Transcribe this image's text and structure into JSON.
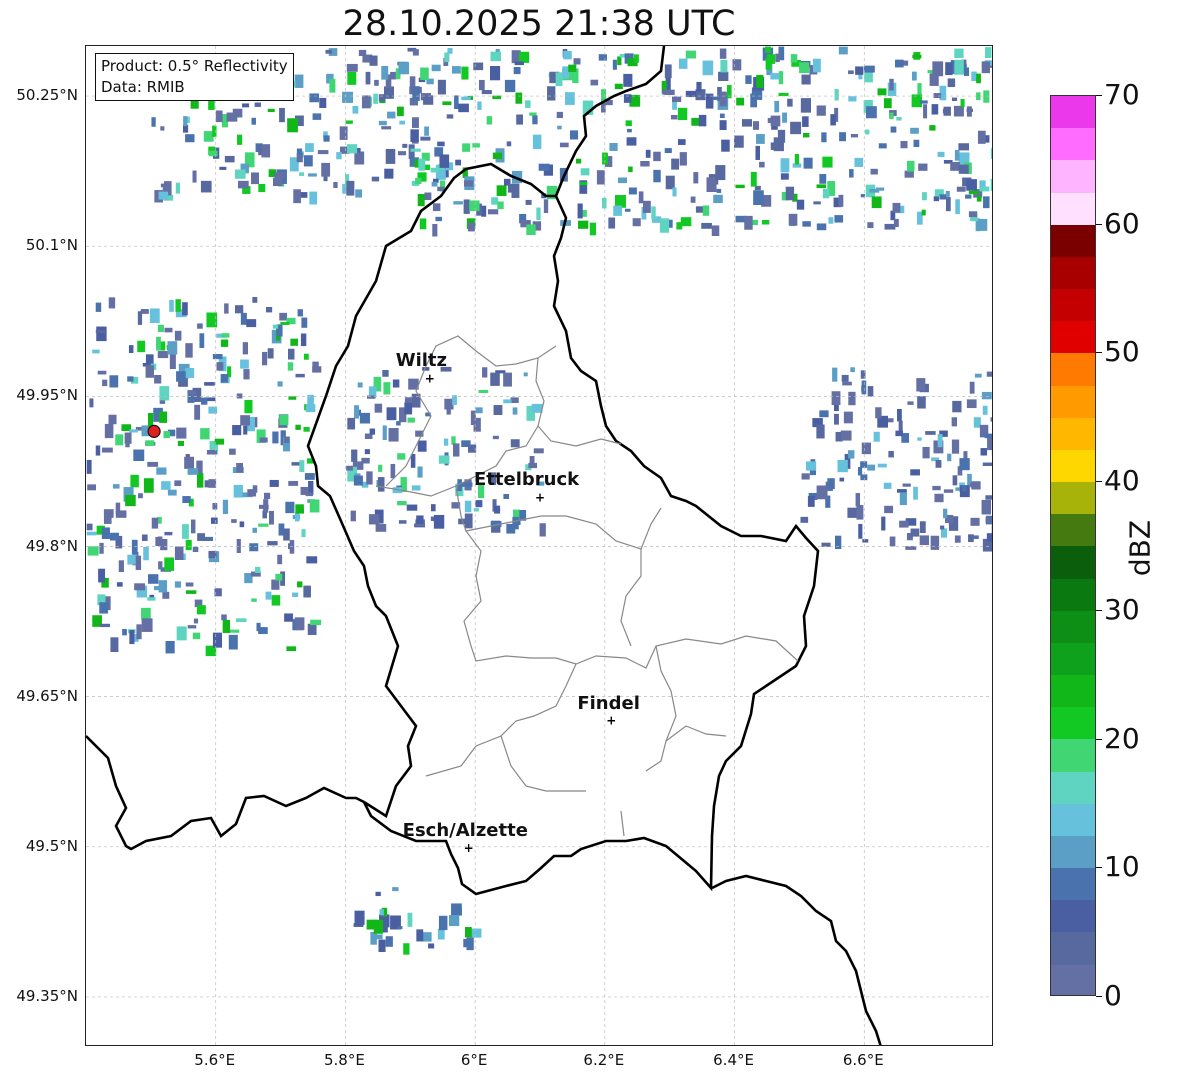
{
  "title": "28.10.2025 21:38 UTC",
  "info": {
    "product": "Product: 0.5° Reflectivity",
    "data_source": "Data: RMIB"
  },
  "axes": {
    "lat_labels": [
      "50.25°N",
      "50.1°N",
      "49.95°N",
      "49.8°N",
      "49.65°N",
      "49.5°N",
      "49.35°N"
    ],
    "lon_labels": [
      "5.6°E",
      "5.8°E",
      "6°E",
      "6.2°E",
      "6.4°E",
      "6.6°E"
    ],
    "lat_values": [
      50.25,
      50.1,
      49.95,
      49.8,
      49.65,
      49.5,
      49.35
    ],
    "lon_values": [
      5.6,
      5.8,
      6.0,
      6.2,
      6.4,
      6.6
    ],
    "lon_range": [
      5.4,
      6.8
    ],
    "lat_range": [
      49.3,
      50.3
    ]
  },
  "cities": [
    {
      "name": "Wiltz",
      "lon": 5.93,
      "lat": 49.968
    },
    {
      "name": "Ettelbruck",
      "lon": 6.1,
      "lat": 49.849
    },
    {
      "name": "Findel",
      "lon": 6.21,
      "lat": 49.626
    },
    {
      "name": "Esch/Alzette",
      "lon": 5.99,
      "lat": 49.499
    }
  ],
  "radar_site": {
    "lon": 5.505,
    "lat": 49.915,
    "color": "#e02020"
  },
  "colorbar": {
    "label": "dBZ",
    "min": 0,
    "max": 70,
    "ticks": [
      "0",
      "10",
      "20",
      "30",
      "40",
      "50",
      "60",
      "70"
    ],
    "tick_values": [
      0,
      10,
      20,
      30,
      40,
      50,
      60,
      70
    ],
    "colors": [
      "#646fa4",
      "#5869a0",
      "#4a5fa2",
      "#4a72ad",
      "#5b9ec6",
      "#66c1dc",
      "#5fd4c0",
      "#3fd673",
      "#11c922",
      "#11b619",
      "#0ea11b",
      "#0c8f14",
      "#0a7a10",
      "#0a5e0c",
      "#457a10",
      "#a8b30a",
      "#ffd700",
      "#ffb700",
      "#ff9a00",
      "#ff7a00",
      "#e00000",
      "#c40000",
      "#a80000",
      "#7a0000",
      "#ffe0ff",
      "#ffb4ff",
      "#ff6cff",
      "#ea38ea"
    ]
  },
  "chart_data": {
    "type": "heatmap",
    "title": "28.10.2025 21:38 UTC",
    "variable": "0.5° Reflectivity",
    "units": "dBZ",
    "xlim": [
      5.4,
      6.8
    ],
    "ylim": [
      49.3,
      50.3
    ],
    "echo_regions": [
      {
        "lon": [
          5.5,
          5.95
        ],
        "lat": [
          50.15,
          50.3
        ],
        "dbz_range": [
          0,
          25
        ]
      },
      {
        "lon": [
          5.9,
          6.8
        ],
        "lat": [
          50.12,
          50.3
        ],
        "dbz_range": [
          0,
          25
        ]
      },
      {
        "lon": [
          5.4,
          5.75
        ],
        "lat": [
          49.7,
          50.05
        ],
        "dbz_range": [
          0,
          25
        ]
      },
      {
        "lon": [
          6.5,
          6.8
        ],
        "lat": [
          49.8,
          49.98
        ],
        "dbz_range": [
          0,
          15
        ]
      },
      {
        "lon": [
          5.8,
          6.1
        ],
        "lat": [
          49.82,
          49.98
        ],
        "dbz_range": [
          0,
          20
        ]
      },
      {
        "lon": [
          5.8,
          6.0
        ],
        "lat": [
          49.4,
          49.46
        ],
        "dbz_range": [
          5,
          25
        ]
      }
    ]
  }
}
